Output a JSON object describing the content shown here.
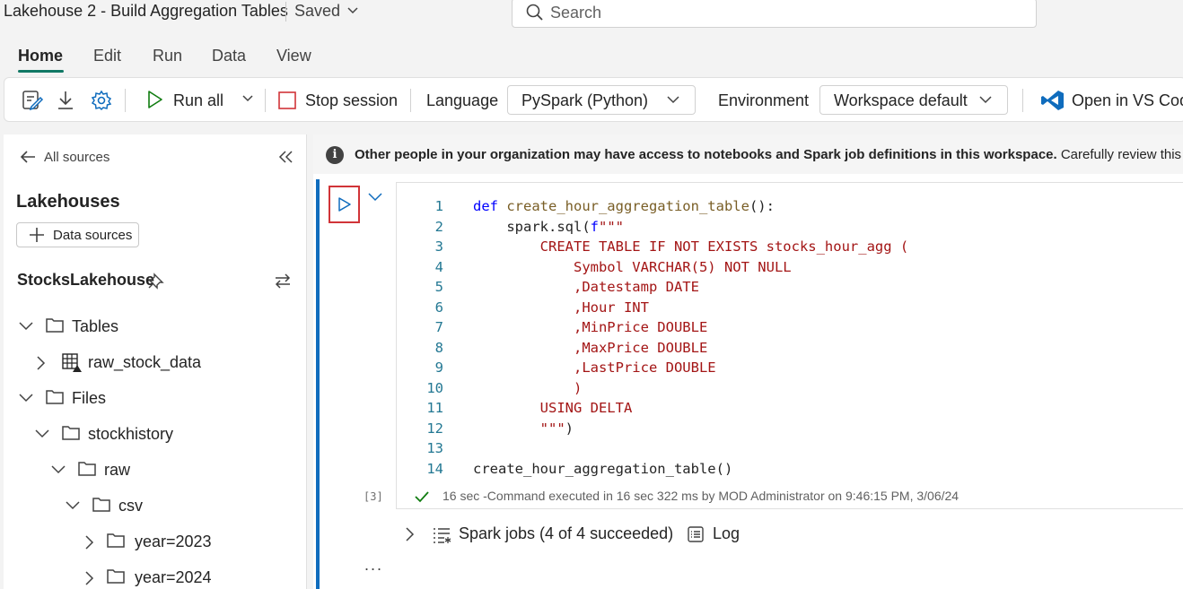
{
  "title_bar": {
    "title": "Lakehouse 2 - Build Aggregation Tables",
    "saved_label": "Saved",
    "search_placeholder": "Search"
  },
  "menu_tabs": [
    {
      "label": "Home",
      "active": true
    },
    {
      "label": "Edit"
    },
    {
      "label": "Run"
    },
    {
      "label": "Data"
    },
    {
      "label": "View"
    }
  ],
  "toolbar": {
    "run_all": "Run all",
    "stop_session": "Stop session",
    "language_label": "Language",
    "language_value": "PySpark (Python)",
    "environment_label": "Environment",
    "environment_value": "Workspace default",
    "open_vscode": "Open in VS Code"
  },
  "sidebar": {
    "back_label": "All sources",
    "heading": "Lakehouses",
    "data_sources_button": "Data sources",
    "lakehouse_name": "StocksLakehouse",
    "tree": [
      {
        "label": "Tables",
        "expanded": true,
        "icon": "folder-icon"
      },
      {
        "label": "raw_stock_data",
        "expanded": false,
        "icon": "table-icon"
      },
      {
        "label": "Files",
        "expanded": true,
        "icon": "folder-icon"
      },
      {
        "label": "stockhistory",
        "expanded": true,
        "icon": "folder-icon"
      },
      {
        "label": "raw",
        "expanded": true,
        "icon": "folder-icon"
      },
      {
        "label": "csv",
        "expanded": true,
        "icon": "folder-icon"
      },
      {
        "label": "year=2023",
        "expanded": false,
        "icon": "folder-icon"
      },
      {
        "label": "year=2024",
        "expanded": false,
        "icon": "folder-icon"
      }
    ]
  },
  "notebook": {
    "info_bold": "Other people in your organization may have access to notebooks and Spark job definitions in this workspace.",
    "info_rest": " Carefully review this item",
    "code_lines": [
      {
        "n": "1",
        "text": "def create_hour_aggregation_table():"
      },
      {
        "n": "2",
        "text": "    spark.sql(f\"\"\""
      },
      {
        "n": "3",
        "text": "        CREATE TABLE IF NOT EXISTS stocks_hour_agg ("
      },
      {
        "n": "4",
        "text": "            Symbol VARCHAR(5) NOT NULL"
      },
      {
        "n": "5",
        "text": "            ,Datestamp DATE"
      },
      {
        "n": "6",
        "text": "            ,Hour INT"
      },
      {
        "n": "7",
        "text": "            ,MinPrice DOUBLE"
      },
      {
        "n": "8",
        "text": "            ,MaxPrice DOUBLE"
      },
      {
        "n": "9",
        "text": "            ,LastPrice DOUBLE"
      },
      {
        "n": "10",
        "text": "            )"
      },
      {
        "n": "11",
        "text": "        USING DELTA"
      },
      {
        "n": "12",
        "text": "        \"\"\")"
      },
      {
        "n": "13",
        "text": ""
      },
      {
        "n": "14",
        "text": "create_hour_aggregation_table()"
      }
    ],
    "execution_count": "[3]",
    "execution_status": "16 sec -Command executed in 16 sec 322 ms by MOD Administrator on 9:46:15 PM, 3/06/24",
    "spark_jobs": "Spark jobs (4 of 4 succeeded)",
    "log_label": "Log",
    "more_label": "..."
  },
  "colors": {
    "accent": "#117865",
    "cell_bar": "#0f6cbd",
    "highlight_box": "#d13438",
    "success": "#107c10"
  }
}
